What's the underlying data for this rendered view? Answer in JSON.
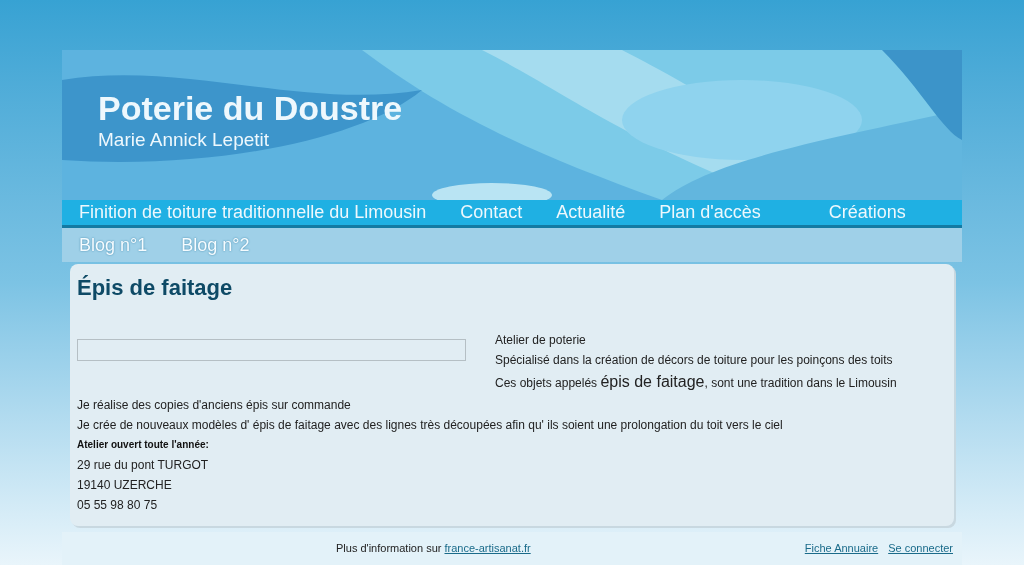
{
  "header": {
    "title": "Poterie du Doustre",
    "subtitle": "Marie Annick Lepetit"
  },
  "nav_rows": [
    [
      "Finition de toiture traditionnelle du Limousin",
      "Contact",
      "Actualité",
      "Plan d'accès",
      "Créations"
    ],
    [
      "Blog n°1",
      "Blog n°2"
    ]
  ],
  "content": {
    "title": "Épis de faitage",
    "side_lines": [
      {
        "text": "Atelier de poterie"
      },
      {
        "text": "Spécialisé dans la création de décors de toiture pour les poinçons des toits"
      },
      {
        "before": "Ces objets appelés ",
        "emphasis": "épis de faitage",
        "after": ", sont une tradition dans le Limousin"
      }
    ],
    "lines": [
      {
        "kind": "text",
        "text": "Je réalise des copies d'anciens épis sur commande"
      },
      {
        "kind": "text",
        "text": "Je crée de nouveaux modèles d' épis de faitage avec des lignes très découpées afin qu' ils soient une prolongation du toit vers le ciel"
      },
      {
        "kind": "heading",
        "text": "Atelier ouvert toute l'année:"
      },
      {
        "kind": "text",
        "text": "29 rue du pont TURGOT"
      },
      {
        "kind": "text",
        "text": "19140 UZERCHE"
      },
      {
        "kind": "text",
        "text": "05 55 98 80 75"
      }
    ]
  },
  "footer": {
    "text": "Plus d'information sur ",
    "link": "france-artisanat.fr",
    "links": [
      "Fiche Annuaire",
      "Se connecter"
    ]
  }
}
